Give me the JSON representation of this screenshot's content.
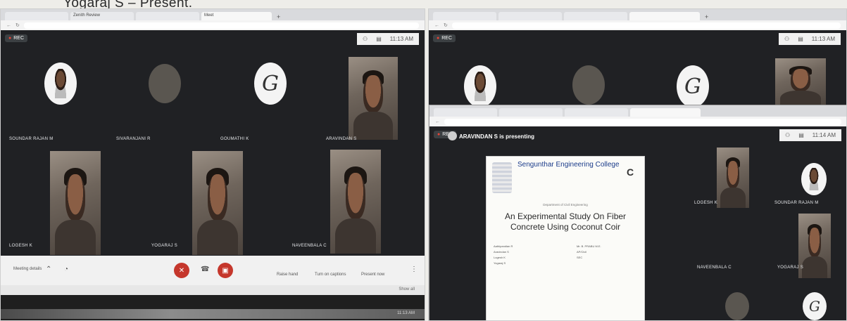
{
  "caption": "Yogaraj S – Present.",
  "left": {
    "tabs": [
      "",
      "Zenith Review",
      "",
      "Meet"
    ],
    "rec_label": "REC",
    "time": "11:13 AM",
    "participants": [
      {
        "name": "SOUNDAR RAJAN M",
        "kind": "avatar-photo"
      },
      {
        "name": "SIVARANJANI R",
        "kind": "avatar-dark"
      },
      {
        "name": "GOUMATHI K",
        "kind": "avatar-logo"
      },
      {
        "name": "ARAVINDAN S",
        "kind": "video"
      },
      {
        "name": "LOGESH K",
        "kind": "video"
      },
      {
        "name": "YOGARAJ S",
        "kind": "video"
      },
      {
        "name": "NAVEENBALA C",
        "kind": "video"
      }
    ],
    "controls": {
      "left_label": "Meeting details",
      "raise_hand": "Raise hand",
      "present": "Present now",
      "captions": "Turn on captions"
    },
    "status_left": "",
    "status_right": "Show all",
    "taskbar_time": "11:13 AM"
  },
  "right": {
    "rec_label": "REC",
    "time_outer": "11:13 AM",
    "time_inner": "11:14 AM",
    "presenting": "ARAVINDAN S is presenting",
    "slide": {
      "college": "Sengunthar Engineering College",
      "department": "Department of Civil Engineering",
      "title": "An Experimental Study On Fiber Concrete Using Coconut Coir",
      "members": [
        "Aathipandian R",
        "Aravindan S",
        "Logesh K",
        "Yogaraj S"
      ],
      "guide_name": "Mr. B. PRABU M.E.",
      "guide_dept": "AP/Civil",
      "guide_college": "SEC"
    },
    "side_names": [
      "LOGESH K",
      "SOUNDAR RAJAN M",
      "NAVEENBALA C",
      "YOGARAJ S"
    ]
  }
}
